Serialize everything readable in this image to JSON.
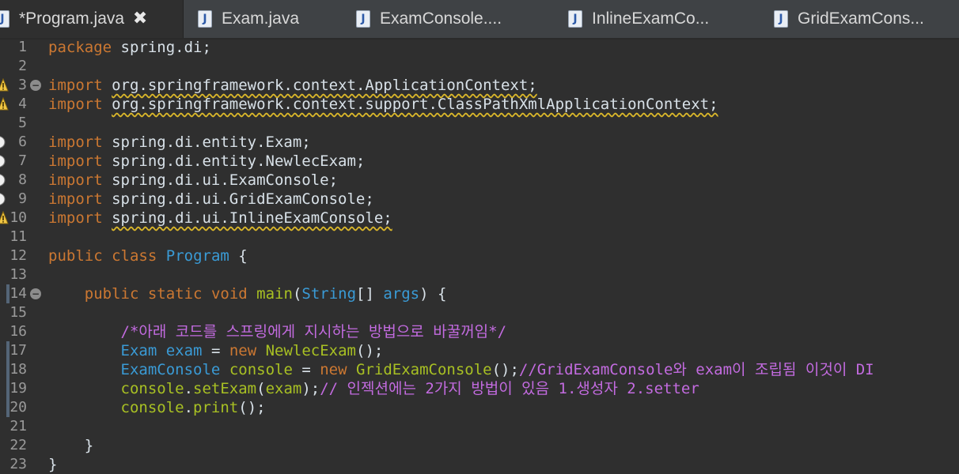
{
  "tabs": [
    {
      "label": "*Program.java",
      "active": true,
      "icon": "java-file-icon",
      "close": "✖"
    },
    {
      "label": "Exam.java",
      "active": false,
      "icon": "java-file-icon"
    },
    {
      "label": "ExamConsole....",
      "active": false,
      "icon": "java-file-icon"
    },
    {
      "label": "InlineExamCo...",
      "active": false,
      "icon": "java-file-icon"
    },
    {
      "label": "GridExamCons...",
      "active": false,
      "icon": "java-file-icon"
    }
  ],
  "editor": {
    "line_numbers": [
      "1",
      "2",
      "3",
      "4",
      "5",
      "6",
      "7",
      "8",
      "9",
      "10",
      "11",
      "12",
      "13",
      "14",
      "15",
      "16",
      "17",
      "18",
      "19",
      "20",
      "21",
      "22",
      "23"
    ],
    "lines": [
      {
        "segments": [
          {
            "t": "package",
            "c": "kw"
          },
          {
            "t": " spring.di;",
            "c": "field"
          }
        ]
      },
      {
        "segments": []
      },
      {
        "segments": [
          {
            "t": "import",
            "c": "kw"
          },
          {
            "t": " ",
            "c": "field"
          },
          {
            "t": "org.springframework.context.ApplicationContext;",
            "c": "field",
            "sq": true
          }
        ]
      },
      {
        "segments": [
          {
            "t": "import",
            "c": "kw"
          },
          {
            "t": " ",
            "c": "field"
          },
          {
            "t": "org.springframework.context.support.ClassPathXmlApplicationContext;",
            "c": "field",
            "sq": true
          }
        ]
      },
      {
        "segments": []
      },
      {
        "segments": [
          {
            "t": "import",
            "c": "kw"
          },
          {
            "t": " spring.di.entity.Exam;",
            "c": "field"
          }
        ]
      },
      {
        "segments": [
          {
            "t": "import",
            "c": "kw"
          },
          {
            "t": " spring.di.entity.NewlecExam;",
            "c": "field"
          }
        ]
      },
      {
        "segments": [
          {
            "t": "import",
            "c": "kw"
          },
          {
            "t": " spring.di.ui.ExamConsole;",
            "c": "field"
          }
        ]
      },
      {
        "segments": [
          {
            "t": "import",
            "c": "kw"
          },
          {
            "t": " spring.di.ui.GridExamConsole;",
            "c": "field"
          }
        ]
      },
      {
        "segments": [
          {
            "t": "import",
            "c": "kw"
          },
          {
            "t": " ",
            "c": "field"
          },
          {
            "t": "spring.di.ui.InlineExamConsole;",
            "c": "field",
            "sq": true
          }
        ]
      },
      {
        "segments": []
      },
      {
        "segments": [
          {
            "t": "public",
            "c": "kw"
          },
          {
            "t": " ",
            "c": "field"
          },
          {
            "t": "class",
            "c": "kw"
          },
          {
            "t": " ",
            "c": "field"
          },
          {
            "t": "Program",
            "c": "cls"
          },
          {
            "t": " {",
            "c": "field"
          }
        ]
      },
      {
        "segments": []
      },
      {
        "segments": [
          {
            "t": "    ",
            "c": "field"
          },
          {
            "t": "public",
            "c": "kw"
          },
          {
            "t": " ",
            "c": "field"
          },
          {
            "t": "static",
            "c": "kw"
          },
          {
            "t": " ",
            "c": "field"
          },
          {
            "t": "void",
            "c": "kw"
          },
          {
            "t": " ",
            "c": "field"
          },
          {
            "t": "main",
            "c": "method"
          },
          {
            "t": "(",
            "c": "field"
          },
          {
            "t": "String",
            "c": "cls"
          },
          {
            "t": "[] ",
            "c": "field"
          },
          {
            "t": "args",
            "c": "cls"
          },
          {
            "t": ") {",
            "c": "field"
          }
        ]
      },
      {
        "segments": []
      },
      {
        "segments": [
          {
            "t": "        ",
            "c": "field"
          },
          {
            "t": "/*아래 코드를 스프링에게 지시하는 방법으로 바꿀꺼임*/",
            "c": "cm"
          }
        ]
      },
      {
        "segments": [
          {
            "t": "        ",
            "c": "field"
          },
          {
            "t": "Exam",
            "c": "cls"
          },
          {
            "t": " ",
            "c": "field"
          },
          {
            "t": "exam",
            "c": "cls"
          },
          {
            "t": " = ",
            "c": "field"
          },
          {
            "t": "new",
            "c": "kw"
          },
          {
            "t": " ",
            "c": "field"
          },
          {
            "t": "NewlecExam",
            "c": "method"
          },
          {
            "t": "();",
            "c": "field"
          }
        ]
      },
      {
        "segments": [
          {
            "t": "        ",
            "c": "field"
          },
          {
            "t": "ExamConsole",
            "c": "cls"
          },
          {
            "t": " ",
            "c": "field"
          },
          {
            "t": "console",
            "c": "method"
          },
          {
            "t": " = ",
            "c": "field"
          },
          {
            "t": "new",
            "c": "kw"
          },
          {
            "t": " ",
            "c": "field"
          },
          {
            "t": "GridExamConsole",
            "c": "method"
          },
          {
            "t": "();",
            "c": "field"
          },
          {
            "t": "//GridExamConsole와 exam이 조립됨 이것이 DI",
            "c": "cm"
          }
        ]
      },
      {
        "segments": [
          {
            "t": "        ",
            "c": "field"
          },
          {
            "t": "console",
            "c": "method"
          },
          {
            "t": ".",
            "c": "field"
          },
          {
            "t": "setExam",
            "c": "method"
          },
          {
            "t": "(",
            "c": "field"
          },
          {
            "t": "exam",
            "c": "method"
          },
          {
            "t": ");",
            "c": "field"
          },
          {
            "t": "// 인젝션에는 2가지 방법이 있음 1.생성자 2.setter",
            "c": "cm"
          }
        ]
      },
      {
        "segments": [
          {
            "t": "        ",
            "c": "field"
          },
          {
            "t": "console",
            "c": "method"
          },
          {
            "t": ".",
            "c": "field"
          },
          {
            "t": "print",
            "c": "method"
          },
          {
            "t": "();",
            "c": "field"
          }
        ]
      },
      {
        "segments": []
      },
      {
        "segments": [
          {
            "t": "    }",
            "c": "field"
          }
        ]
      },
      {
        "segments": [
          {
            "t": "}",
            "c": "field"
          }
        ]
      }
    ]
  },
  "markers": {
    "warnings": [
      3,
      4,
      10
    ],
    "breakpoints": [
      6,
      7,
      8,
      9
    ],
    "folds": [
      3,
      14
    ],
    "changed": [
      14,
      17,
      18,
      19,
      20
    ]
  },
  "colors": {
    "background": "#2f2f2f",
    "keyword": "#cc7832",
    "type": "#3a9bd6",
    "method": "#a8c023",
    "comment": "#c36be0",
    "warning_squiggle": "#d9b62a"
  }
}
